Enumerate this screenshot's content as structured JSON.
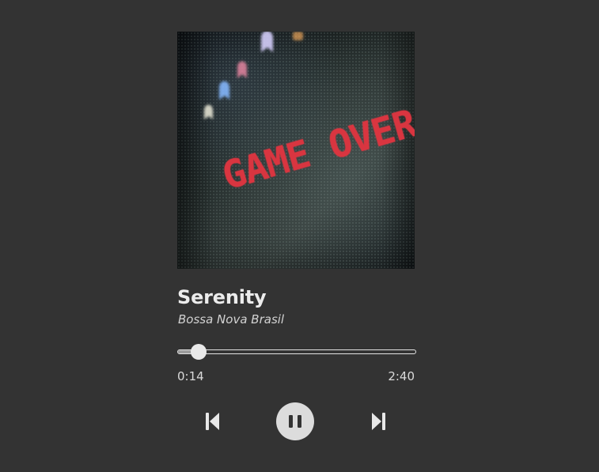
{
  "player": {
    "cover_text": "GAME OVER",
    "title": "Serenity",
    "artist": "Bossa Nova Brasil",
    "progress": 0.0875,
    "current_time": "0:14",
    "duration": "2:40",
    "controls": {
      "previous": "skip-previous-icon",
      "pause": "pause-icon",
      "next": "skip-next-icon"
    },
    "colors": {
      "background": "#333333",
      "text": "#e6e6e6",
      "cover_text": "#d9363f"
    }
  }
}
